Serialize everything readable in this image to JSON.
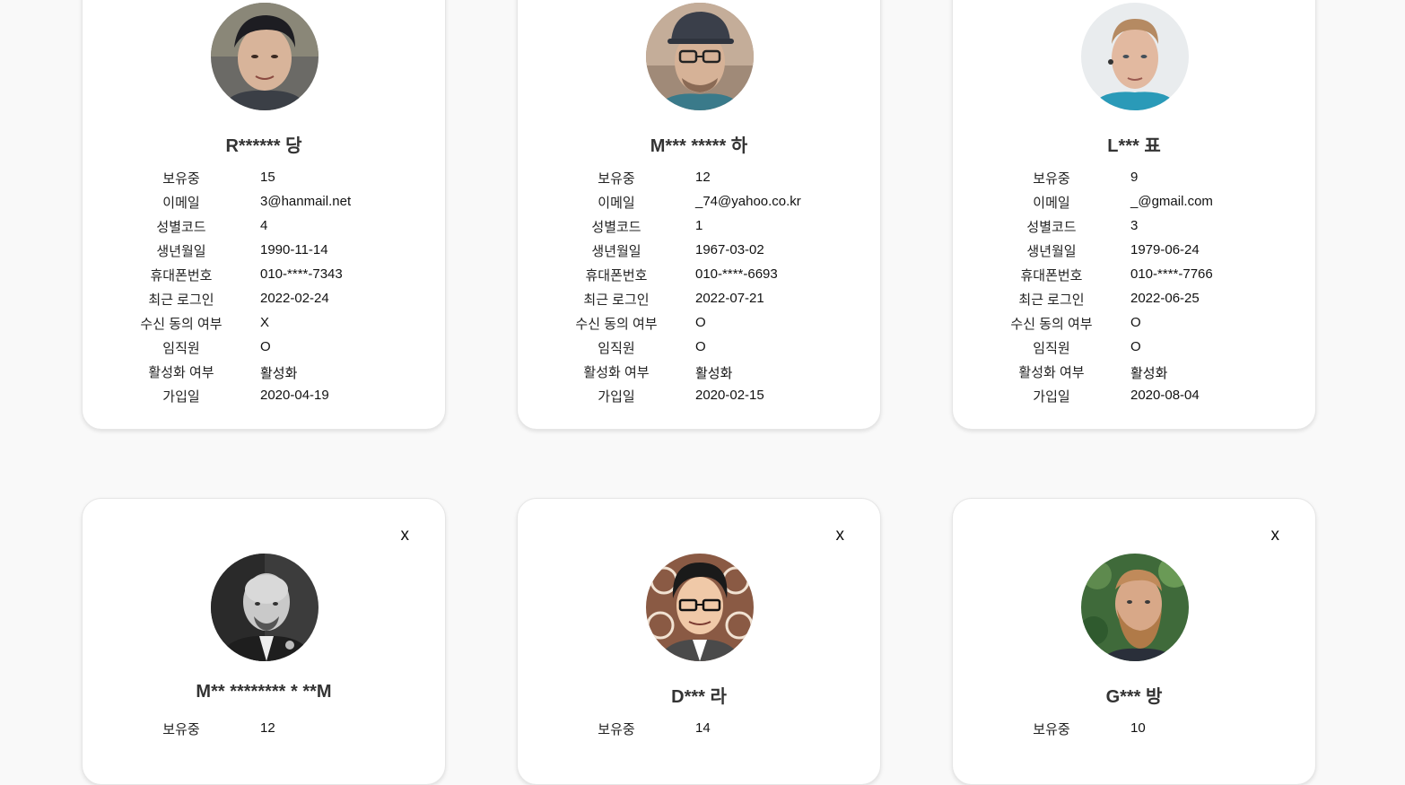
{
  "labels": {
    "holdings": "보유중",
    "email": "이메일",
    "gender_code": "성별코드",
    "birth_date": "생년월일",
    "phone": "휴대폰번호",
    "last_login": "최근 로그인",
    "consent": "수신 동의 여부",
    "employee": "임직원",
    "active": "활성화 여부",
    "joined": "가입일"
  },
  "close_label": "x",
  "users": [
    {
      "name": "R****** 당",
      "holdings": "15",
      "email": "3@hanmail.net",
      "gender_code": "4",
      "birth_date": "1990-11-14",
      "phone": "010-****-7343",
      "last_login": "2022-02-24",
      "consent": "X",
      "employee": "O",
      "active": "활성화",
      "joined": "2020-04-19"
    },
    {
      "name": "M*** ***** 하",
      "holdings": "12",
      "email": "_74@yahoo.co.kr",
      "gender_code": "1",
      "birth_date": "1967-03-02",
      "phone": "010-****-6693",
      "last_login": "2022-07-21",
      "consent": "O",
      "employee": "O",
      "active": "활성화",
      "joined": "2020-02-15"
    },
    {
      "name": "L*** 표",
      "holdings": "9",
      "email": "_@gmail.com",
      "gender_code": "3",
      "birth_date": "1979-06-24",
      "phone": "010-****-7766",
      "last_login": "2022-06-25",
      "consent": "O",
      "employee": "O",
      "active": "활성화",
      "joined": "2020-08-04"
    },
    {
      "name": "M** ******** * **M",
      "holdings": "12"
    },
    {
      "name": "D*** 라",
      "holdings": "14"
    },
    {
      "name": "G*** 방",
      "holdings": "10"
    }
  ]
}
